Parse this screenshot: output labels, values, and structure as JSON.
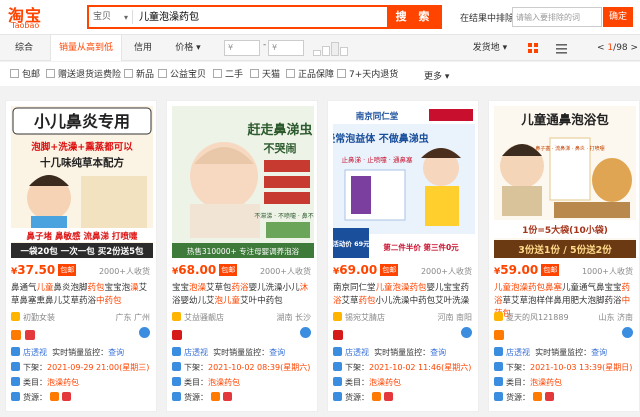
{
  "header": {
    "logo_cn": "淘宝",
    "logo_en": "Taobao",
    "search_category": "宝贝",
    "search_query": "儿童泡澡药包",
    "search_button": "搜 索",
    "result_search_label": "在结果中排除",
    "result_search_placeholder": "请输入要排除的词",
    "confirm_button": "确定"
  },
  "sort_tabs": [
    {
      "label": "综合"
    },
    {
      "label": "销量从高到低"
    },
    {
      "label": "信用"
    },
    {
      "label": "价格"
    }
  ],
  "price_filter": {
    "min_placeholder": "¥",
    "max_placeholder": "¥",
    "dash": "-"
  },
  "ship_to": "发货地",
  "pager": {
    "current": "1",
    "total": "/98"
  },
  "filters": [
    {
      "label": "包邮"
    },
    {
      "label": "赠送退货运费险"
    },
    {
      "label": "新品"
    },
    {
      "label": "公益宝贝"
    },
    {
      "label": "二手"
    },
    {
      "label": "天猫"
    },
    {
      "label": "正品保障"
    },
    {
      "label": "7+天内退货"
    }
  ],
  "more_label": "更多",
  "products": [
    {
      "img_top": "小儿鼻炎专用",
      "img_mid": "泡脚+洗澡+熏蒸都可以",
      "img_line": "十几味纯草本配方",
      "img_bottom": "鼻子堵 鼻敏感 流鼻涕 打喷嚏",
      "img_promo": "一袋20包 一次一包 买2份送5包",
      "price": "37.50",
      "price_currency": "¥",
      "tag": "包邮",
      "sales": "2000+人收货",
      "title_a": "鼻通气",
      "title_b": "儿童",
      "title_c": "鼻炎泡脚",
      "title_d": "药包",
      "title_e": "宝宝泡",
      "title_f": "澡",
      "title_g": "艾草",
      "title_h": "鼻塞熏鼻儿艾草药浴",
      "title_i": "中药包",
      "shop": "初勤女装",
      "loc": "广东 广州",
      "row1_k": "店透视",
      "row1_v": "实时销量监控：",
      "row1_link": "查询",
      "row2_k": "下架：",
      "row2_v": "2021-09-29 21:00(星期三)",
      "row3_k": "类目：",
      "row3_v": "泡澡药包",
      "row4_k": "货源："
    },
    {
      "img_top": "赶走鼻涕虫",
      "img_mid": "不哭闹",
      "img_line": "不滞涕 · 不喷嚏 · 鼻不堵",
      "img_bottom": "热售310000+ 专注母婴调养泡浴",
      "img_promo": "",
      "price": "68.00",
      "price_currency": "¥",
      "tag": "包邮",
      "sales": "2000+人收货",
      "title_a": "宝宝",
      "title_b": "泡澡",
      "title_c": "艾草包",
      "title_d": "药浴",
      "title_e": "婴儿洗澡小儿",
      "title_f": "沐",
      "title_g": "浴",
      "title_h": "婴幼儿艾",
      "title_i": "泡",
      "title_j": "儿童",
      "title_k": "艾叶中药包",
      "shop": "艾益骚靓店",
      "loc": "湖南 长沙",
      "row1_k": "店透视",
      "row1_v": "实时销量监控：",
      "row1_link": "查询",
      "row2_k": "下架：",
      "row2_v": "2021-10-02 08:39(星期六)",
      "row3_k": "类目：",
      "row3_v": "泡澡药包",
      "row4_k": "货源："
    },
    {
      "img_top": "南京同仁堂",
      "img_mid": "经常泡益体 不做鼻涕虫",
      "img_line": "止鼻涕 · 止喷嚏 · 通鼻塞",
      "img_bottom": "第二件半价 第三件0元",
      "img_promo": "活动价 69元",
      "price": "69.00",
      "price_currency": "¥",
      "tag": "包邮",
      "sales": "2000+人收货",
      "title_a": "南京同仁堂",
      "title_b": "儿童泡澡药包",
      "title_c": "婴儿宝宝药",
      "title_d": "浴",
      "title_e": "艾草",
      "title_f": "药包",
      "title_g": "小儿洗澡",
      "title_h": "中药包艾叶洗澡",
      "shop": "锡宛艾腈店",
      "loc": "河南 南阳",
      "row1_k": "店透视",
      "row1_v": "实时销量监控：",
      "row1_link": "查询",
      "row2_k": "下架：",
      "row2_v": "2021-10-02 11:46(星期六)",
      "row3_k": "类目：",
      "row3_v": "泡澡药包",
      "row4_k": "货源："
    },
    {
      "img_top": "儿童通鼻泡浴包",
      "img_mid": "鼻子塞 · 流鼻涕 · 鼻炎 · 打喷嚏",
      "img_line": "1份=5大袋(10小袋)",
      "img_bottom": "3份送1份 / 5份送2份",
      "img_promo": "",
      "price": "59.00",
      "price_currency": "¥",
      "tag": "包邮",
      "sales": "1000+人收货",
      "title_a": "儿童泡澡药包",
      "title_b": "鼻塞",
      "title_c": "儿童通气鼻宝宝",
      "title_d": "药",
      "title_e": "浴",
      "title_f": "草",
      "title_g": "艾草泡",
      "title_h": "样伴鼻用肥大泡脚药浴",
      "title_i": "中药包",
      "shop": "夏天的风121889",
      "loc": "山东 济南",
      "row1_k": "店透视",
      "row1_v": "实时销量监控：",
      "row1_link": "查询",
      "row2_k": "下架：",
      "row2_v": "2021-10-03 13:39(星期日)",
      "row3_k": "类目：",
      "row3_v": "泡澡药包",
      "row4_k": "货源："
    }
  ],
  "colors": {
    "brand": "#ff4400",
    "link": "#3b73d8"
  }
}
